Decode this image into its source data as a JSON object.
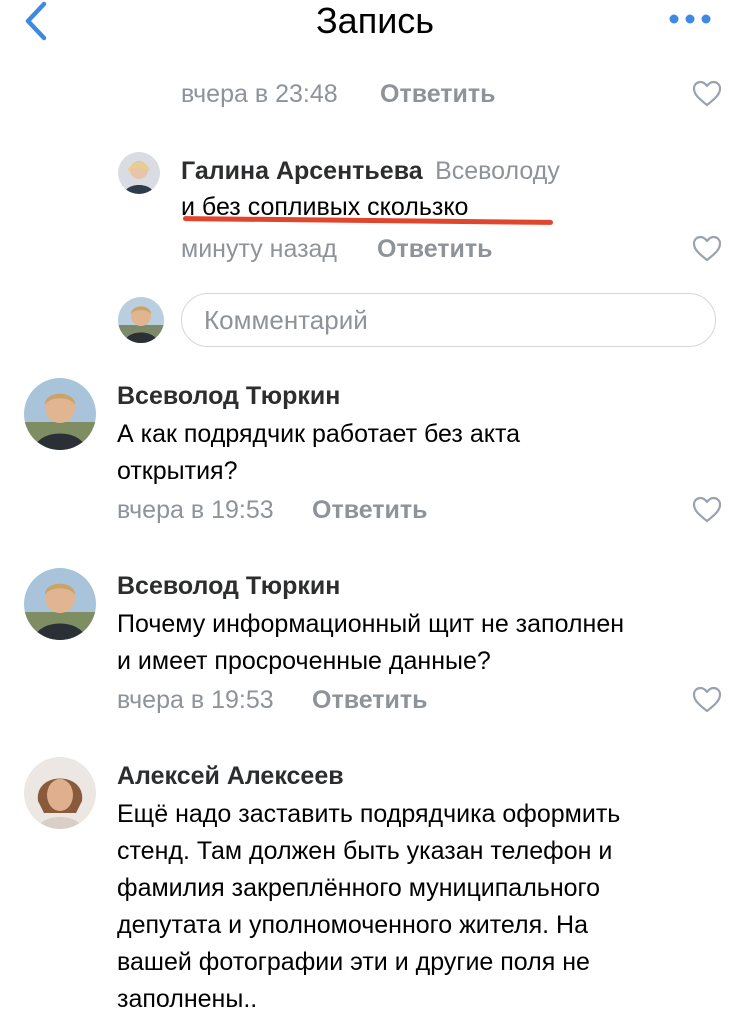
{
  "header": {
    "title": "Запись"
  },
  "colors": {
    "accent": "#3f8ae0",
    "underline": "#e0452e"
  },
  "top_meta": {
    "time": "вчера в 23:48",
    "reply": "Ответить"
  },
  "reply_comment": {
    "author": "Галина Арсентьева",
    "addressee": "Всеволоду",
    "text": "и без сопливых скользко",
    "time": "минуту назад",
    "reply": "Ответить"
  },
  "composer": {
    "placeholder": "Комментарий"
  },
  "comments": [
    {
      "author": "Всеволод Тюркин",
      "text_lines": [
        "А как подрядчик работает без акта",
        "открытия?"
      ],
      "time": "вчера в 19:53",
      "reply": "Ответить"
    },
    {
      "author": "Всеволод Тюркин",
      "text_lines": [
        "Почему информационный щит не заполнен",
        "и имеет просроченные данные?"
      ],
      "time": "вчера в 19:53",
      "reply": "Ответить"
    },
    {
      "author": "Алексей Алексеев",
      "text_lines": [
        "Ещё надо заставить подрядчика оформить",
        "стенд. Там должен быть указан телефон и",
        "фамилия закреплённого муниципального",
        "депутата и уполномоченного жителя. На",
        "вашей фотографии эти и другие поля не",
        "заполнены.."
      ]
    }
  ]
}
